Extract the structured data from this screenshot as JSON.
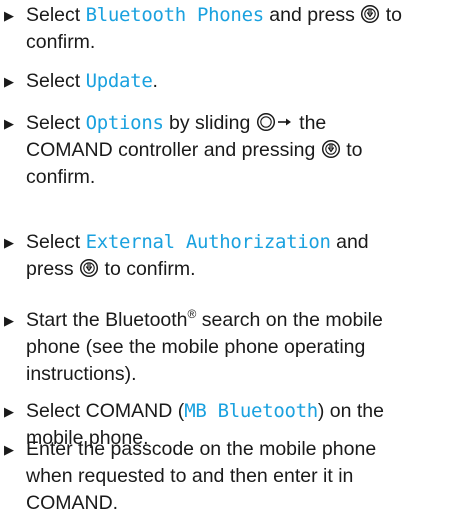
{
  "steps": [
    {
      "lines": [
        [
          "Select ",
          {
            "hl": "Bluetooth Phones"
          },
          " and press ",
          {
            "icon": "press-controller-icon"
          },
          " to"
        ],
        [
          "confirm."
        ]
      ]
    },
    {
      "lines": [
        [
          "Select ",
          {
            "hl": "Update"
          },
          "."
        ]
      ]
    },
    {
      "lines": [
        [
          "Select ",
          {
            "hl": "Options"
          },
          " by sliding ",
          {
            "icon": "slide-right-controller-icon"
          },
          " the"
        ],
        [
          "COMAND controller and pressing ",
          {
            "icon": "press-controller-icon"
          },
          " to"
        ],
        [
          "confirm."
        ]
      ]
    },
    {
      "lines": [
        [
          "Select ",
          {
            "hl": "External Authorization"
          },
          " and"
        ],
        [
          "press ",
          {
            "icon": "press-controller-icon"
          },
          " to confirm."
        ]
      ]
    },
    {
      "lines": [
        [
          "Start the Bluetooth",
          {
            "sup": "®"
          },
          " search on the mobile"
        ],
        [
          "phone (see the mobile phone operating"
        ],
        [
          "instructions)."
        ]
      ]
    },
    {
      "lines": [
        [
          "Select COMAND (",
          {
            "hl": "MB Bluetooth"
          },
          ") on the"
        ],
        [
          "mobile phone."
        ]
      ]
    },
    {
      "lines": [
        [
          "Enter the passcode on the mobile phone"
        ],
        [
          "when requested to and then enter it in"
        ],
        [
          "COMAND."
        ]
      ]
    }
  ],
  "bullet_glyph": "▶",
  "colors": {
    "text": "#1a1a1a",
    "highlight": "#1aa1df"
  }
}
